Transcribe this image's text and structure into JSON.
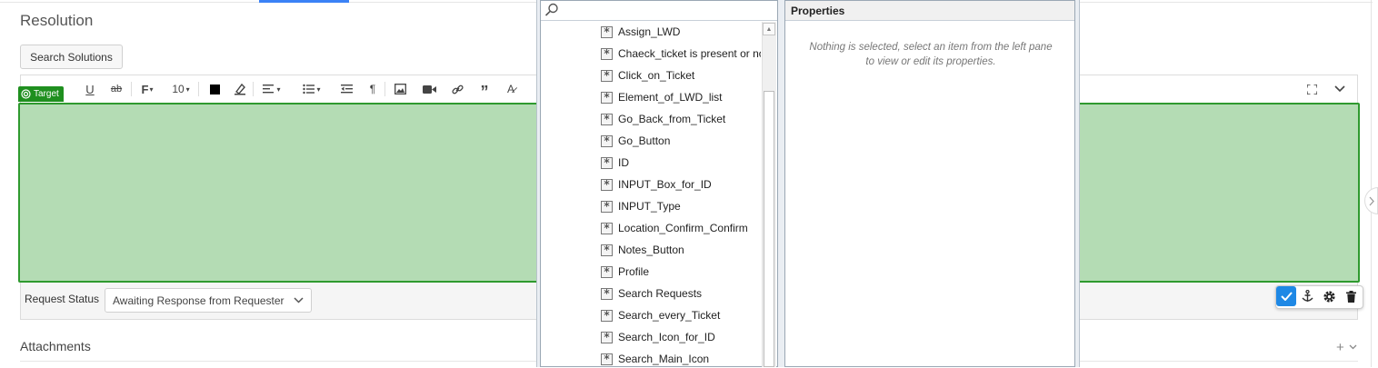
{
  "page": {
    "resolution_title": "Resolution",
    "search_solutions": "Search Solutions",
    "target_badge": "Target",
    "font_size": "10",
    "request_status_label": "Request Status",
    "request_status_value": "Awaiting Response from Requester",
    "attachments_title": "Attachments",
    "attachments_add": "+"
  },
  "explorer": {
    "properties_title": "Properties",
    "properties_empty": "Nothing is selected, select an item from the left pane to view or edit its properties.",
    "items": [
      "Assign_LWD",
      "Chaeck_ticket is present or not",
      "Click_on_Ticket",
      "Element_of_LWD_list",
      "Go_Back_from_Ticket",
      "Go_Button",
      "ID",
      "INPUT_Box_for_ID",
      "INPUT_Type",
      "Location_Confirm_Confirm",
      "Notes_Button",
      "Profile",
      "Search Requests",
      "Search_every_Ticket",
      "Search_Icon_for_ID",
      "Search_Main_Icon"
    ]
  },
  "colors": {
    "target_green": "#1f8f1f",
    "editor_fill": "#b4dcb4",
    "accent_blue": "#1e88e5"
  }
}
